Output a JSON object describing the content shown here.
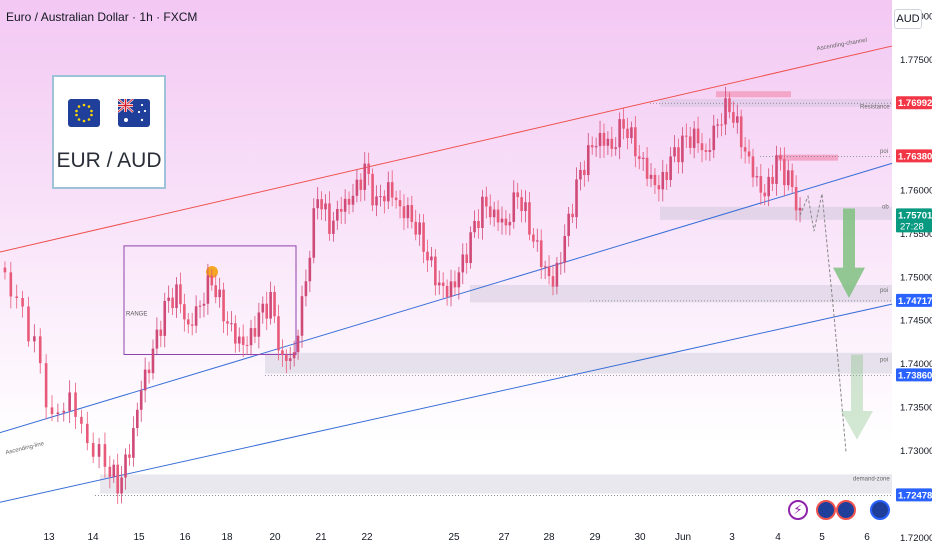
{
  "header": {
    "title": "Euro / Australian Dollar · 1h · FXCM",
    "currency": "AUD"
  },
  "flag_box": {
    "pair": "EUR / AUD"
  },
  "colors": {
    "background_top": "#f3c8f3",
    "background_bottom": "#ffffff",
    "resistance_line": "#ef5350",
    "support_line": "#3a6fd8",
    "candle": "#e0557a",
    "arrow": "#7fbf7f"
  },
  "chart_data": {
    "type": "candlestick",
    "symbol": "Euro / Australian Dollar",
    "timeframe": "1h",
    "ylim": [
      1.7185,
      1.7818
    ],
    "y_ticks": [
      1.78,
      1.775,
      1.76,
      1.755,
      1.75,
      1.745,
      1.74,
      1.735,
      1.73,
      1.72
    ],
    "y_tick_labels": [
      "1.78000",
      "1.77500",
      "1.76000",
      "1.75500",
      "1.75000",
      "1.74500",
      "1.74000",
      "1.73500",
      "1.73000",
      "1.72000"
    ],
    "x_tick_labels": [
      "13",
      "14",
      "15",
      "16",
      "18",
      "20",
      "21",
      "22",
      "25",
      "27",
      "28",
      "29",
      "30",
      "Jun",
      "3",
      "4",
      "5",
      "6"
    ],
    "price_labels": [
      {
        "value": "1.76992",
        "color": "#f23645"
      },
      {
        "value": "1.76380",
        "color": "#f23645"
      },
      {
        "value": "1.75701",
        "countdown": "27:28",
        "color": "#089981"
      },
      {
        "value": "1.74717",
        "color": "#2962ff"
      },
      {
        "value": "1.73860",
        "color": "#2962ff"
      },
      {
        "value": "1.72478",
        "color": "#2962ff"
      }
    ],
    "annotations": [
      "Ascending-channel",
      "Resistance",
      "poi",
      "ob",
      "poi",
      "poi",
      "demand-zone",
      "Ascending-line",
      "RANGE"
    ],
    "price_path": [
      [
        0,
        1.751
      ],
      [
        3,
        1.747
      ],
      [
        6,
        1.742
      ],
      [
        9,
        1.733
      ],
      [
        12,
        1.736
      ],
      [
        15,
        1.731
      ],
      [
        18,
        1.729
      ],
      [
        20,
        1.7262
      ],
      [
        22,
        1.73
      ],
      [
        24,
        1.737
      ],
      [
        26,
        1.741
      ],
      [
        28,
        1.746
      ],
      [
        30,
        1.748
      ],
      [
        32,
        1.744
      ],
      [
        34,
        1.747
      ],
      [
        36,
        1.75
      ],
      [
        38,
        1.746
      ],
      [
        40,
        1.743
      ],
      [
        42,
        1.742
      ],
      [
        44,
        1.745
      ],
      [
        46,
        1.747
      ],
      [
        48,
        1.74
      ],
      [
        50,
        1.741
      ],
      [
        52,
        1.75
      ],
      [
        54,
        1.76
      ],
      [
        56,
        1.756
      ],
      [
        58,
        1.758
      ],
      [
        60,
        1.759
      ],
      [
        62,
        1.762
      ],
      [
        64,
        1.758
      ],
      [
        66,
        1.76
      ],
      [
        68,
        1.758
      ],
      [
        70,
        1.757
      ],
      [
        72,
        1.754
      ],
      [
        74,
        1.75
      ],
      [
        76,
        1.748
      ],
      [
        78,
        1.75
      ],
      [
        80,
        1.754
      ],
      [
        82,
        1.758
      ],
      [
        84,
        1.757
      ],
      [
        86,
        1.756
      ],
      [
        88,
        1.76
      ],
      [
        90,
        1.756
      ],
      [
        92,
        1.752
      ],
      [
        94,
        1.749
      ],
      [
        96,
        1.754
      ],
      [
        98,
        1.76
      ],
      [
        100,
        1.764
      ],
      [
        102,
        1.766
      ],
      [
        104,
        1.765
      ],
      [
        106,
        1.768
      ],
      [
        108,
        1.765
      ],
      [
        110,
        1.762
      ],
      [
        112,
        1.76
      ],
      [
        114,
        1.763
      ],
      [
        116,
        1.765
      ],
      [
        118,
        1.766
      ],
      [
        120,
        1.764
      ],
      [
        122,
        1.768
      ],
      [
        124,
        1.77
      ],
      [
        126,
        1.766
      ],
      [
        128,
        1.762
      ],
      [
        130,
        1.759
      ],
      [
        132,
        1.763
      ],
      [
        134,
        1.761
      ],
      [
        136,
        1.757
      ]
    ],
    "projection": [
      [
        1.757
      ],
      [
        1.759
      ],
      [
        1.756
      ],
      [
        1.745
      ],
      [
        1.73
      ]
    ]
  }
}
